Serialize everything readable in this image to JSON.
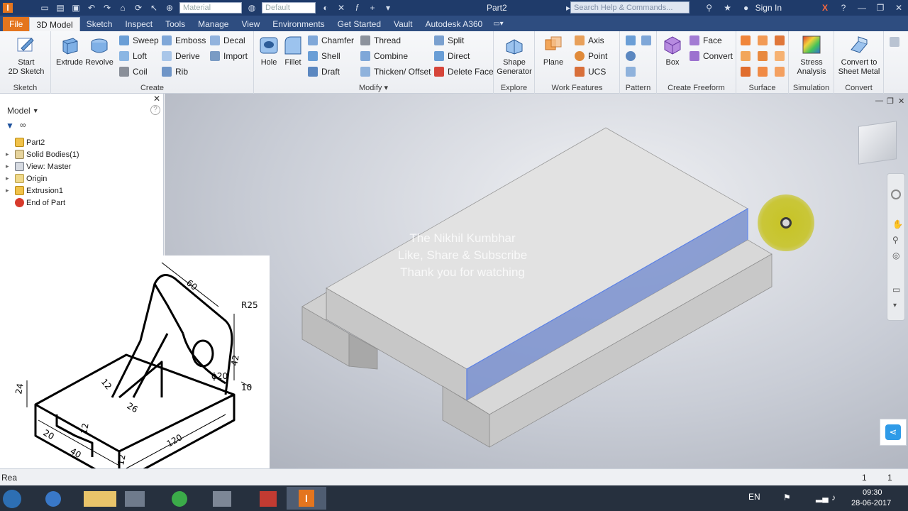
{
  "titlebar": {
    "document_title": "Part2",
    "material_combo": "Material",
    "appearance_combo": "Default",
    "search_placeholder": "Search Help & Commands...",
    "sign_in": "Sign In"
  },
  "tabs": [
    "File",
    "3D Model",
    "Sketch",
    "Inspect",
    "Tools",
    "Manage",
    "View",
    "Environments",
    "Get Started",
    "Vault",
    "Autodesk A360"
  ],
  "ribbon": {
    "sketch": {
      "label": "Sketch",
      "start_line1": "Start",
      "start_line2": "2D Sketch"
    },
    "create": {
      "label": "Create",
      "extrude": "Extrude",
      "revolve": "Revolve",
      "sweep": "Sweep",
      "loft": "Loft",
      "coil": "Coil",
      "emboss": "Emboss",
      "derive": "Derive",
      "rib": "Rib",
      "decal": "Decal",
      "import": "Import"
    },
    "modify": {
      "label": "Modify",
      "hole": "Hole",
      "fillet": "Fillet",
      "chamfer": "Chamfer",
      "shell": "Shell",
      "draft": "Draft",
      "thread": "Thread",
      "combine": "Combine",
      "thicken": "Thicken/ Offset",
      "split": "Split",
      "direct": "Direct",
      "delete_face": "Delete Face"
    },
    "explore": {
      "label": "Explore",
      "shape_line1": "Shape",
      "shape_line2": "Generator"
    },
    "work_features": {
      "label": "Work Features",
      "plane": "Plane",
      "axis": "Axis",
      "point": "Point",
      "ucs": "UCS"
    },
    "pattern": {
      "label": "Pattern"
    },
    "freeform": {
      "label": "Create Freeform",
      "box": "Box",
      "face": "Face",
      "convert": "Convert"
    },
    "surface": {
      "label": "Surface"
    },
    "simulation": {
      "label": "Simulation",
      "stress_line1": "Stress",
      "stress_line2": "Analysis"
    },
    "convert": {
      "label": "Convert",
      "sheet_line1": "Convert to",
      "sheet_line2": "Sheet Metal"
    }
  },
  "browser": {
    "title": "Model",
    "items": [
      {
        "label": "Part2"
      },
      {
        "label": "Solid Bodies(1)"
      },
      {
        "label": "View: Master"
      },
      {
        "label": "Origin"
      },
      {
        "label": "Extrusion1"
      },
      {
        "label": "End of Part"
      }
    ]
  },
  "overlay": {
    "line1": "The Nikhil Kumbhar",
    "line2": "Like, Share & Subscribe",
    "line3": "Thank you for watching"
  },
  "drawing": {
    "dims": [
      "60",
      "R25",
      "42",
      "10",
      "ϕ20",
      "12",
      "26",
      "24",
      "20",
      "40",
      "20",
      "12",
      "12",
      "120"
    ]
  },
  "status": {
    "left": "Rea",
    "count1": "1",
    "count2": "1"
  },
  "taskbar": {
    "lang": "EN",
    "time": "09:30",
    "date": "28-06-2017"
  },
  "colors": {
    "title_bar": "#1f3b6a",
    "tab_bar": "#2e4d80",
    "file_tab": "#e4751e",
    "selection_face": "#6f88d8",
    "cursor_highlight": "#c6c21a"
  }
}
